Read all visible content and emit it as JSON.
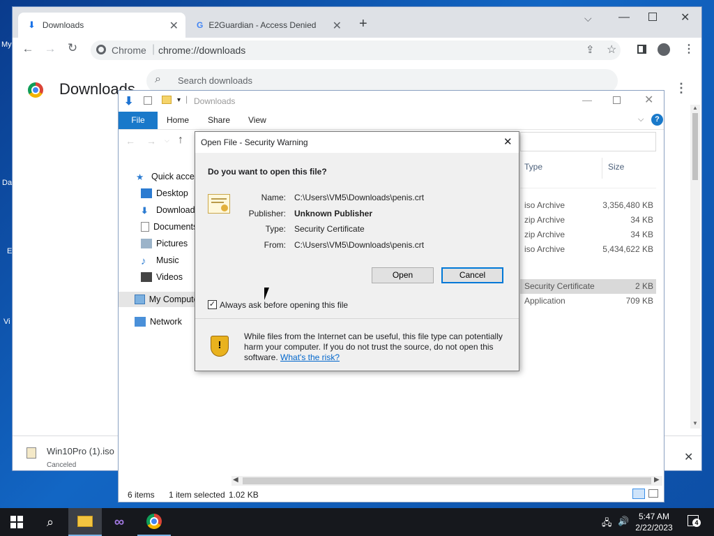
{
  "chrome": {
    "tabs": [
      {
        "label": "Downloads",
        "active": true
      },
      {
        "label": "E2Guardian - Access Denied",
        "active": false
      }
    ],
    "omnibox": {
      "site_label": "Chrome",
      "url": "chrome://downloads"
    },
    "page_title": "Downloads",
    "search_placeholder": "Search downloads",
    "shelf_item": {
      "name": "Win10Pro (1).iso",
      "status": "Canceled"
    }
  },
  "explorer": {
    "title": "Downloads",
    "ribbon_tabs": [
      "File",
      "Home",
      "Share",
      "View"
    ],
    "nav": [
      "Quick access",
      "Desktop",
      "Downloads",
      "Documents",
      "Pictures",
      "Music",
      "Videos",
      "My Computer",
      "Network"
    ],
    "columns": {
      "type": "Type",
      "size": "Size"
    },
    "rows": [
      {
        "type": "iso Archive",
        "size": "3,356,480 KB",
        "selected": false
      },
      {
        "type": "zip Archive",
        "size": "34 KB",
        "selected": false
      },
      {
        "type": "zip Archive",
        "size": "34 KB",
        "selected": false
      },
      {
        "type": "iso Archive",
        "size": "5,434,622 KB",
        "selected": false
      },
      {
        "type": "Security Certificate",
        "size": "2 KB",
        "selected": true
      },
      {
        "type": "Application",
        "size": "709 KB",
        "selected": false
      }
    ],
    "status": {
      "items": "6 items",
      "selected": "1 item selected",
      "size": "1.02 KB"
    }
  },
  "dialog": {
    "title": "Open File - Security Warning",
    "question": "Do you want to open this file?",
    "fields": [
      {
        "label": "Name:",
        "value": "C:\\Users\\VM5\\Downloads\\penis.crt",
        "bold": false
      },
      {
        "label": "Publisher:",
        "value": "Unknown Publisher",
        "bold": true
      },
      {
        "label": "Type:",
        "value": "Security Certificate",
        "bold": false
      },
      {
        "label": "From:",
        "value": "C:\\Users\\VM5\\Downloads\\penis.crt",
        "bold": false
      }
    ],
    "open_label": "Open",
    "cancel_label": "Cancel",
    "checkbox_label": "Always ask before opening this file",
    "checkbox_checked": true,
    "warning_text": "While files from the Internet can be useful, this file type can potentially harm your computer. If you do not trust the source, do not open this software.",
    "risk_link": "What's the risk?"
  },
  "desktop_icons": [
    "My",
    "Da",
    "E",
    "Vi"
  ],
  "taskbar": {
    "time": "5:47 AM",
    "date": "2/22/2023",
    "notification_count": "4"
  }
}
